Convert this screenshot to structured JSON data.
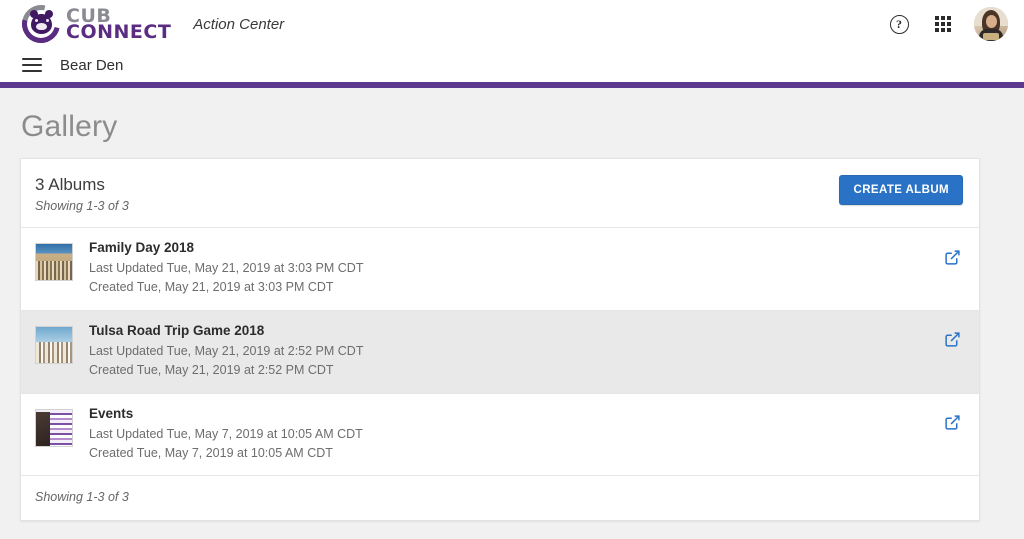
{
  "brand": {
    "logo_line1": "CUB",
    "logo_line2": "CONNECT",
    "app_title": "Action Center"
  },
  "topbar": {
    "help_icon": "help-circle-icon",
    "apps_icon": "apps-grid-icon",
    "avatar_icon": "user-avatar"
  },
  "nav": {
    "menu_icon": "hamburger-menu-icon",
    "title": "Bear Den",
    "accent_color": "#5b3a8e"
  },
  "page": {
    "title": "Gallery",
    "background": "#f1f1f1"
  },
  "gallery": {
    "count_label": "3 Albums",
    "showing_top": "Showing 1-3 of 3",
    "showing_bottom": "Showing 1-3 of 3",
    "create_button": "CREATE ALBUM",
    "create_button_color": "#2a72c6",
    "link_icon_color": "#2a72c6",
    "albums": [
      {
        "title": "Family Day 2018",
        "last_updated": "Last Updated Tue, May 21, 2019 at 3:03 PM CDT",
        "created": "Created Tue, May 21, 2019 at 3:03 PM CDT",
        "thumb": "family-day-thumbnail",
        "open_icon": "external-link-icon",
        "highlighted": false
      },
      {
        "title": "Tulsa Road Trip Game 2018",
        "last_updated": "Last Updated Tue, May 21, 2019 at 2:52 PM CDT",
        "created": "Created Tue, May 21, 2019 at 2:52 PM CDT",
        "thumb": "tulsa-road-trip-thumbnail",
        "open_icon": "external-link-icon",
        "highlighted": true
      },
      {
        "title": "Events",
        "last_updated": "Last Updated Tue, May 7, 2019 at 10:05 AM CDT",
        "created": "Created Tue, May 7, 2019 at 10:05 AM CDT",
        "thumb": "events-thumbnail",
        "open_icon": "external-link-icon",
        "highlighted": false
      }
    ]
  }
}
